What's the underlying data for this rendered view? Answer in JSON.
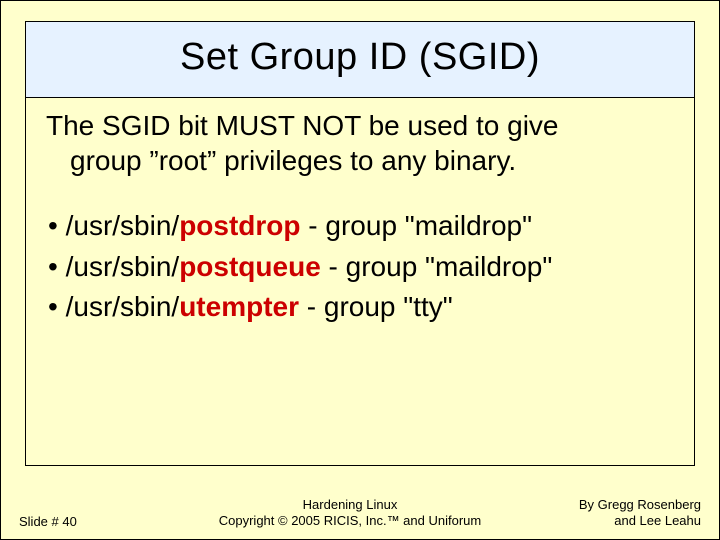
{
  "title": "Set Group ID (SGID)",
  "intro_line1": "The SGID bit MUST NOT be used to give",
  "intro_line2": "group ”root” privileges to any binary.",
  "bullets": [
    {
      "prefix": "/usr/sbin/",
      "cmd": "postdrop",
      "suffix": " - group \"maildrop\""
    },
    {
      "prefix": "/usr/sbin/",
      "cmd": "postqueue",
      "suffix": " - group \"maildrop\""
    },
    {
      "prefix": "/usr/sbin/",
      "cmd": "utempter",
      "suffix": " - group \"tty\""
    }
  ],
  "footer": {
    "slide_label": "Slide # 40",
    "center_line1": "Hardening Linux",
    "center_line2": "Copyright © 2005 RICIS, Inc.™ and Uniforum",
    "right_line1": "By Gregg Rosenberg",
    "right_line2": "and Lee Leahu"
  }
}
